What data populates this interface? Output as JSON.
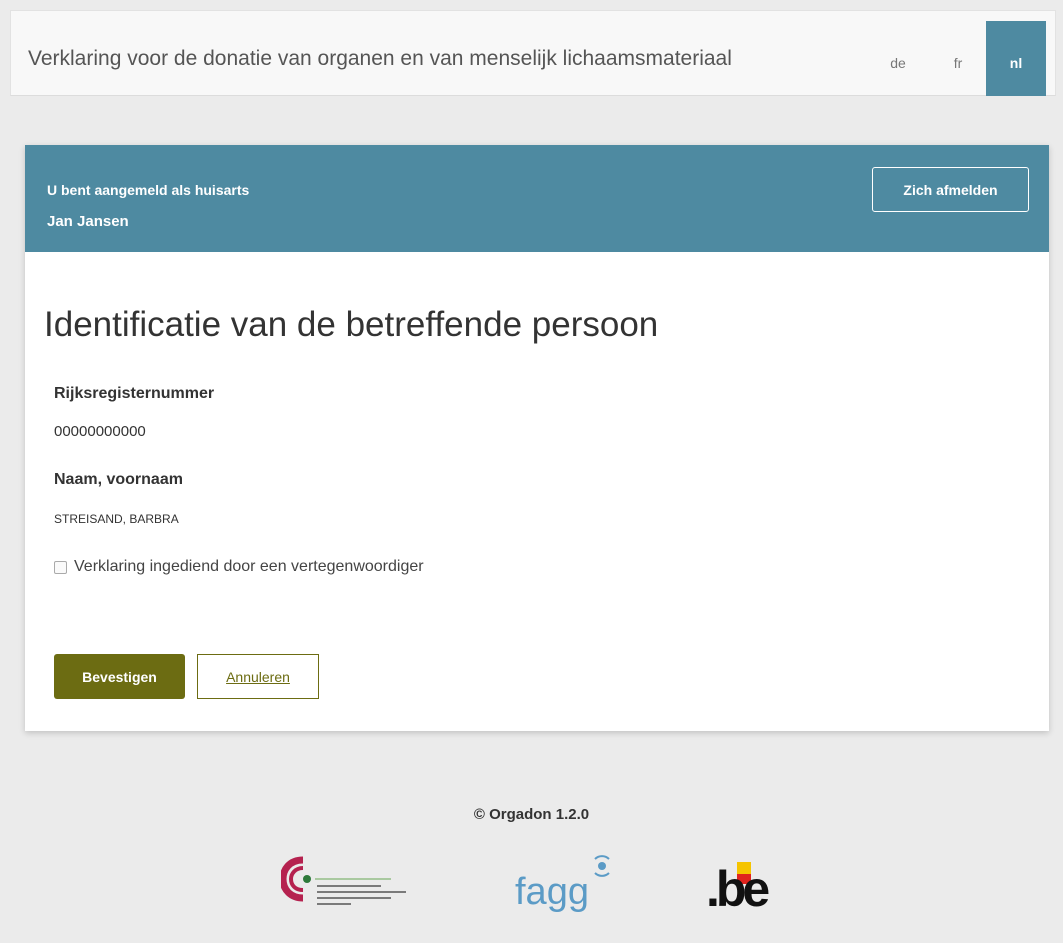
{
  "header": {
    "title": "Verklaring voor de donatie van organen en van menselijk lichaamsmateriaal",
    "languages": [
      {
        "code": "de",
        "active": false
      },
      {
        "code": "fr",
        "active": false
      },
      {
        "code": "nl",
        "active": true
      }
    ]
  },
  "session": {
    "logged_in_as": "U bent aangemeld als huisarts",
    "user_name": "Jan Jansen",
    "logout_label": "Zich afmelden"
  },
  "form": {
    "title": "Identificatie van de betreffende persoon",
    "fields": [
      {
        "label": "Rijksregisternummer",
        "value": "00000000000"
      },
      {
        "label": "Naam, voornaam",
        "value": "STREISAND, BARBRA"
      }
    ],
    "representative_checkbox": {
      "label": "Verklaring ingediend door een vertegenwoordiger",
      "checked": false
    },
    "confirm_label": "Bevestigen",
    "cancel_label": "Annuleren"
  },
  "footer": {
    "copyright": "© Orgadon 1.2.0",
    "logos": [
      "gezondheid-logo",
      "fagg-logo",
      "be-logo"
    ],
    "fagg_text": "fagg",
    "be_text": ".be"
  },
  "colors": {
    "header_accent": "#4e8aa1",
    "button_olive": "#6c6c12",
    "page_background": "#ebebeb"
  }
}
